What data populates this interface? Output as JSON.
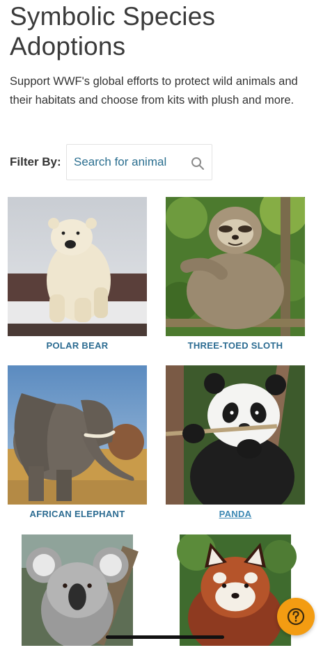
{
  "page": {
    "title": "Symbolic Species Adoptions",
    "intro": "Support WWF's global efforts to protect wild animals and their habitats and choose from kits with plush and more."
  },
  "filter": {
    "label": "Filter By:",
    "search_placeholder": "Search for animal",
    "search_value": ""
  },
  "animals": [
    {
      "name": "POLAR BEAR"
    },
    {
      "name": "THREE-TOED SLOTH"
    },
    {
      "name": "AFRICAN ELEPHANT"
    },
    {
      "name": "PANDA"
    },
    {
      "name": ""
    },
    {
      "name": ""
    }
  ],
  "help": {
    "icon": "question-mark-icon",
    "color": "#f39c12"
  },
  "colors": {
    "link": "#2b6b91",
    "accent": "#f39c12"
  }
}
